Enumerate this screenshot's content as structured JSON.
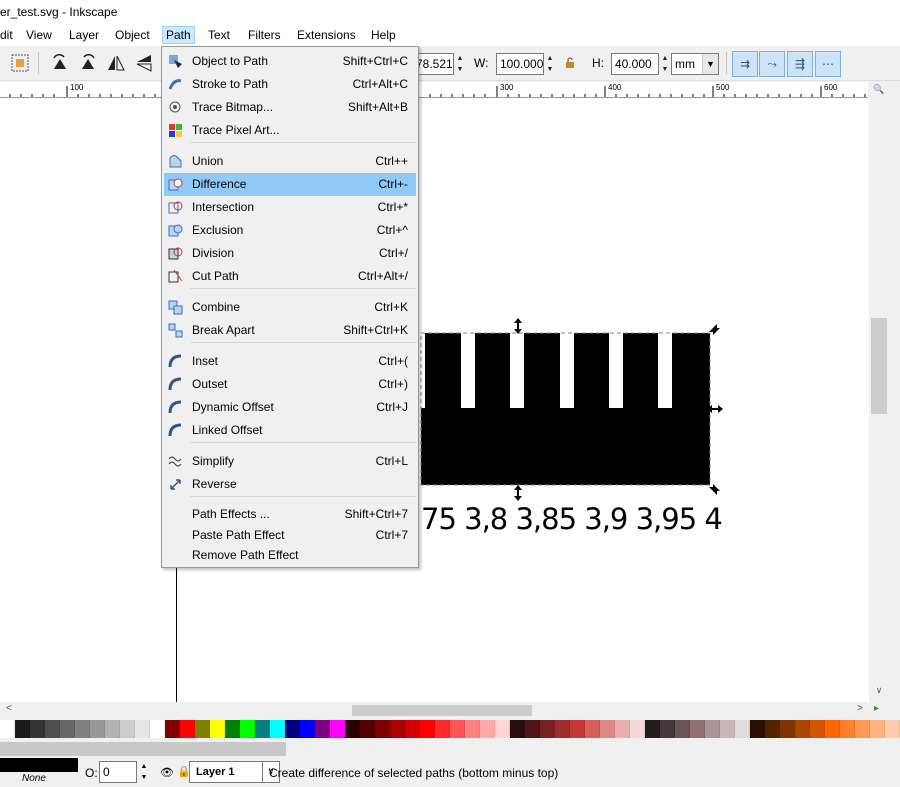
{
  "window": {
    "title": "er_test.svg - Inkscape"
  },
  "menubar": {
    "items": [
      "dit",
      "View",
      "Layer",
      "Object",
      "Path",
      "Text",
      "Filters",
      "Extensions",
      "Help"
    ],
    "active": "Path"
  },
  "toolbar": {
    "x_value": "78.521",
    "w_label": "W:",
    "w_value": "100.000",
    "h_label": "H:",
    "h_value": "40.000",
    "unit": "mm"
  },
  "ruler": {
    "labels": [
      "100",
      "300",
      "400",
      "500",
      "600"
    ]
  },
  "path_menu": {
    "items": [
      {
        "label": "Object to Path",
        "shortcut": "Shift+Ctrl+C",
        "icon": "object-to-path-icon"
      },
      {
        "label": "Stroke to Path",
        "shortcut": "Ctrl+Alt+C",
        "icon": "stroke-to-path-icon"
      },
      {
        "label": "Trace Bitmap...",
        "shortcut": "Shift+Alt+B",
        "icon": "trace-bitmap-icon"
      },
      {
        "label": "Trace Pixel Art...",
        "shortcut": "",
        "icon": "trace-pixel-art-icon"
      },
      {
        "label": "Union",
        "shortcut": "Ctrl++",
        "icon": "union-icon"
      },
      {
        "label": "Difference",
        "shortcut": "Ctrl+-",
        "icon": "difference-icon"
      },
      {
        "label": "Intersection",
        "shortcut": "Ctrl+*",
        "icon": "intersection-icon"
      },
      {
        "label": "Exclusion",
        "shortcut": "Ctrl+^",
        "icon": "exclusion-icon"
      },
      {
        "label": "Division",
        "shortcut": "Ctrl+/",
        "icon": "division-icon"
      },
      {
        "label": "Cut Path",
        "shortcut": "Ctrl+Alt+/",
        "icon": "cut-path-icon"
      },
      {
        "label": "Combine",
        "shortcut": "Ctrl+K",
        "icon": "combine-icon"
      },
      {
        "label": "Break Apart",
        "shortcut": "Shift+Ctrl+K",
        "icon": "break-apart-icon"
      },
      {
        "label": "Inset",
        "shortcut": "Ctrl+(",
        "icon": "inset-icon"
      },
      {
        "label": "Outset",
        "shortcut": "Ctrl+)",
        "icon": "outset-icon"
      },
      {
        "label": "Dynamic Offset",
        "shortcut": "Ctrl+J",
        "icon": "dynamic-offset-icon"
      },
      {
        "label": "Linked Offset",
        "shortcut": "",
        "icon": "linked-offset-icon"
      },
      {
        "label": "Simplify",
        "shortcut": "Ctrl+L",
        "icon": "simplify-icon"
      },
      {
        "label": "Reverse",
        "shortcut": "",
        "icon": "reverse-icon"
      },
      {
        "label": "Path Effects ...",
        "shortcut": "Shift+Ctrl+7",
        "icon": ""
      },
      {
        "label": "Paste Path Effect",
        "shortcut": "Ctrl+7",
        "icon": ""
      },
      {
        "label": "Remove Path Effect",
        "shortcut": "",
        "icon": ""
      }
    ],
    "highlighted": "Difference"
  },
  "canvas": {
    "scale_text": "75 3,8 3,85 3,9 3,95 4"
  },
  "palette": {
    "colors": [
      "#ffffff",
      "#1a1a1a",
      "#333333",
      "#4d4d4d",
      "#666666",
      "#808080",
      "#999999",
      "#b3b3b3",
      "#cccccc",
      "#e6e6e6",
      "#ffffff",
      "#800000",
      "#ff0000",
      "#808000",
      "#ffff00",
      "#008000",
      "#00ff00",
      "#008080",
      "#00ffff",
      "#000080",
      "#0000ff",
      "#800080",
      "#ff00ff",
      "#2b0000",
      "#550000",
      "#800000",
      "#aa0000",
      "#d40000",
      "#ff0000",
      "#ff2a2a",
      "#ff5555",
      "#ff8080",
      "#ffaaaa",
      "#ffd5d5",
      "#280b0b",
      "#501616",
      "#782121",
      "#a02c2c",
      "#c83737",
      "#d35f5f",
      "#de8787",
      "#e9afaf",
      "#f4d7d7",
      "#241c1c",
      "#483737",
      "#6c5353",
      "#916f6f",
      "#ac9393",
      "#c8b7b7",
      "#e3dbdb",
      "#2b1100",
      "#552200",
      "#803300",
      "#aa4400",
      "#d45500",
      "#ff6600",
      "#ff7f2a",
      "#ff9955",
      "#ffb380",
      "#ffccaa"
    ]
  },
  "statusbar": {
    "stroke_label": "None",
    "opacity_label": "O:",
    "opacity_value": "0",
    "layer": "Layer 1",
    "message": "Create difference of selected paths (bottom minus top)"
  }
}
